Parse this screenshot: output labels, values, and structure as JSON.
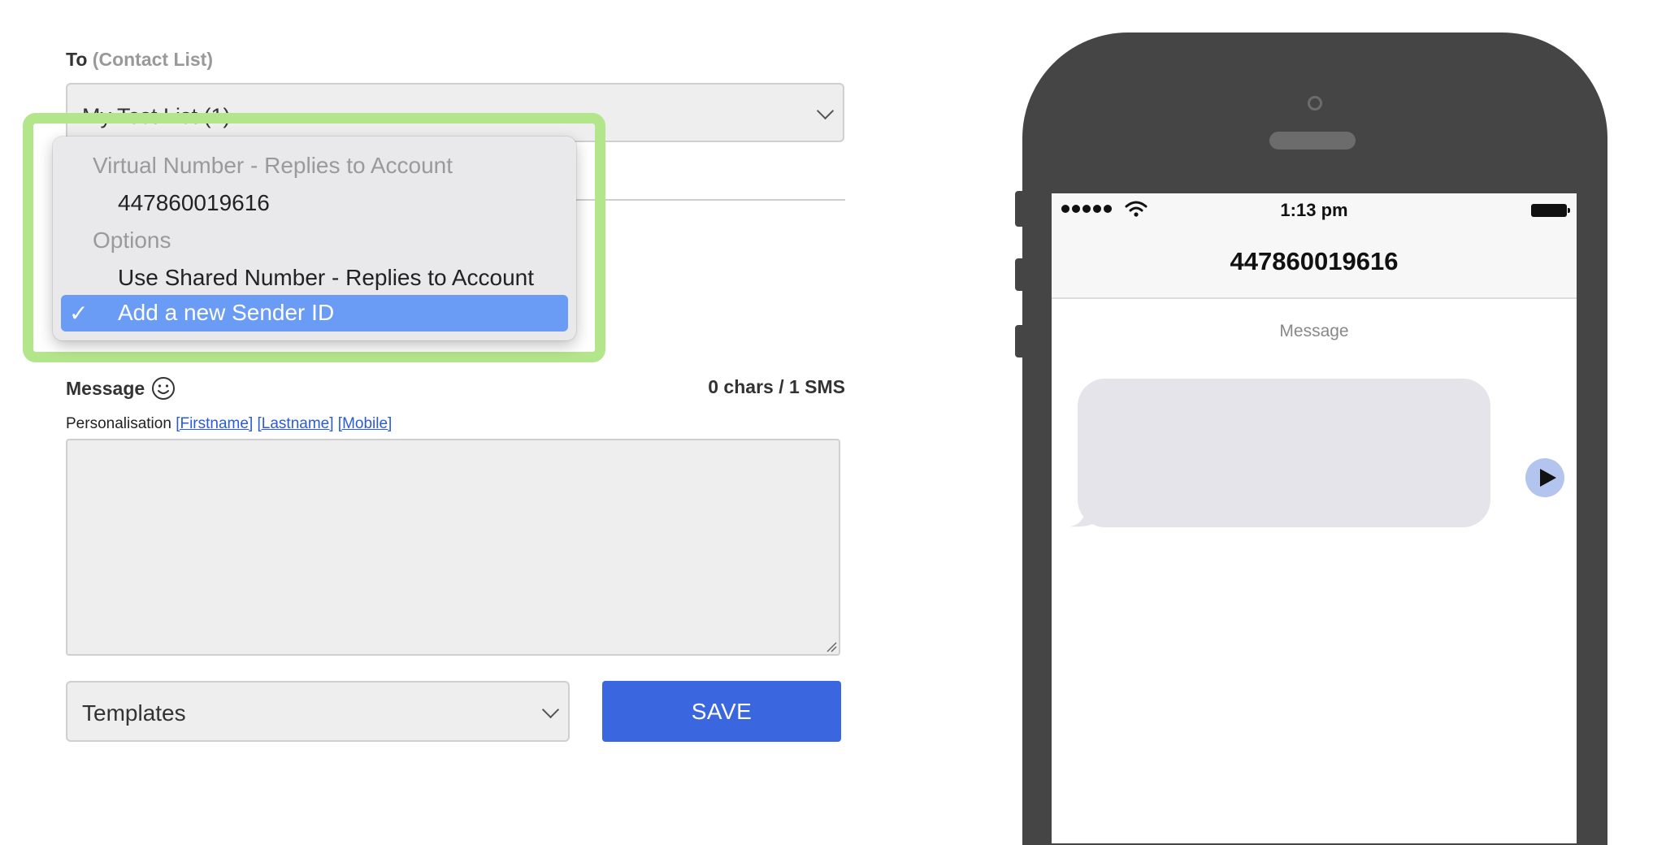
{
  "form": {
    "to_label": "To",
    "to_hint": "(Contact List)",
    "contact_list_value": "My Test List (1)",
    "message_label": "Message",
    "char_count": "0 chars / 1 SMS",
    "personalisation_label": "Personalisation",
    "personalisation_tags": [
      "[Firstname]",
      "[Lastname]",
      "[Mobile]"
    ],
    "message_value": "",
    "templates_value": "Templates",
    "save_label": "SAVE"
  },
  "sender_dropdown": {
    "groups": [
      {
        "label": "Virtual Number - Replies to Account",
        "options": [
          "447860019616"
        ]
      },
      {
        "label": "Options",
        "options": [
          "Use Shared Number - Replies to Account",
          "Add a new Sender ID"
        ]
      }
    ],
    "selected": "Add a new Sender ID",
    "check_glyph": "✓",
    "highlight_color": "#b3e58a"
  },
  "phone_preview": {
    "time": "1:13 pm",
    "contact": "447860019616",
    "message_caption": "Message",
    "message_text": ""
  },
  "colors": {
    "primary_button": "#3a66df",
    "selected_option": "#6a9cf5",
    "phone_body": "#454545",
    "send_button": "#b3c4ef"
  }
}
